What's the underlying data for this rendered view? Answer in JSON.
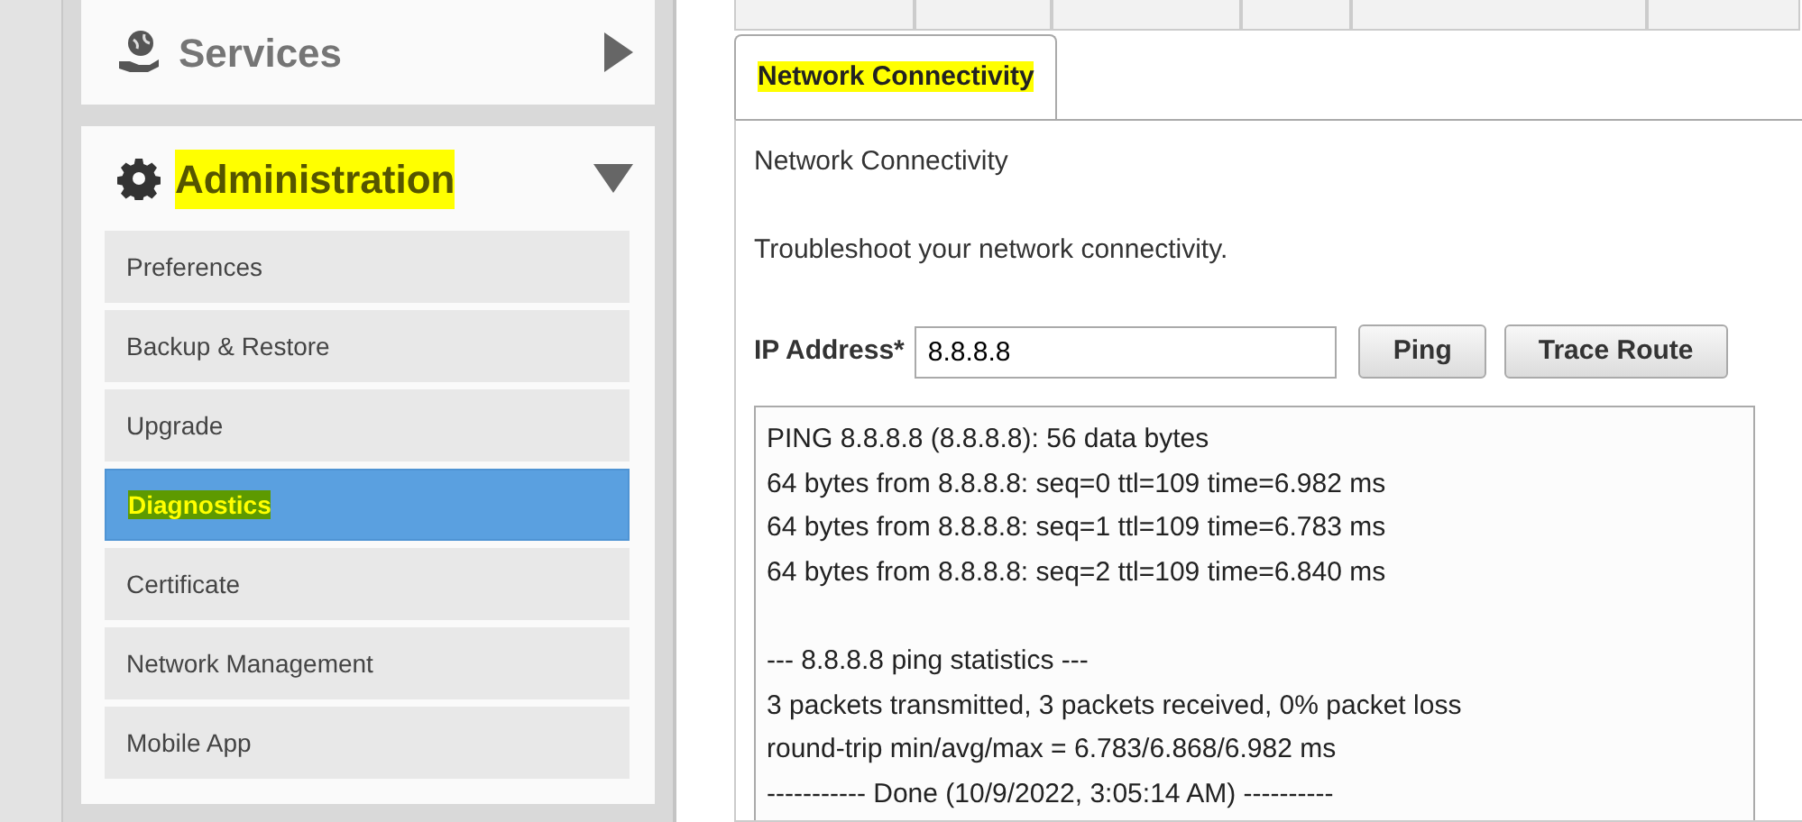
{
  "sidebar": {
    "sections": [
      {
        "title": "Services",
        "expanded": false,
        "highlighted": false
      },
      {
        "title": "Administration",
        "expanded": true,
        "highlighted": true,
        "items": [
          {
            "label": "Preferences",
            "selected": false,
            "highlighted": false
          },
          {
            "label": "Backup & Restore",
            "selected": false,
            "highlighted": false
          },
          {
            "label": "Upgrade",
            "selected": false,
            "highlighted": false
          },
          {
            "label": "Diagnostics",
            "selected": true,
            "highlighted": true
          },
          {
            "label": "Certificate",
            "selected": false,
            "highlighted": false
          },
          {
            "label": "Network Management",
            "selected": false,
            "highlighted": false
          },
          {
            "label": "Mobile App",
            "selected": false,
            "highlighted": false
          }
        ]
      }
    ]
  },
  "subtabs": [
    {
      "label": "Network Connectivity",
      "selected": true,
      "highlighted": true
    }
  ],
  "panel": {
    "legend": "Network Connectivity",
    "intro": "Troubleshoot your network connectivity.",
    "ip_label": "IP Address*",
    "ip_value": "8.8.8.8",
    "buttons": [
      "Ping",
      "Trace Route"
    ],
    "output": [
      [
        "PING 8.8.8.8 (8.8.8.8): 56 data bytes",
        "64 bytes from 8.8.8.8: seq=0 ttl=109 time=6.982 ms",
        "64 bytes from 8.8.8.8: seq=1 ttl=109 time=6.783 ms",
        "64 bytes from 8.8.8.8: seq=2 ttl=109 time=6.840 ms"
      ],
      [
        "--- 8.8.8.8 ping statistics ---",
        "3 packets transmitted, 3 packets received, 0% packet loss",
        "round-trip min/avg/max = 6.783/6.868/6.982 ms",
        "----------- Done (10/9/2022, 3:05:14 AM) ----------"
      ]
    ]
  }
}
